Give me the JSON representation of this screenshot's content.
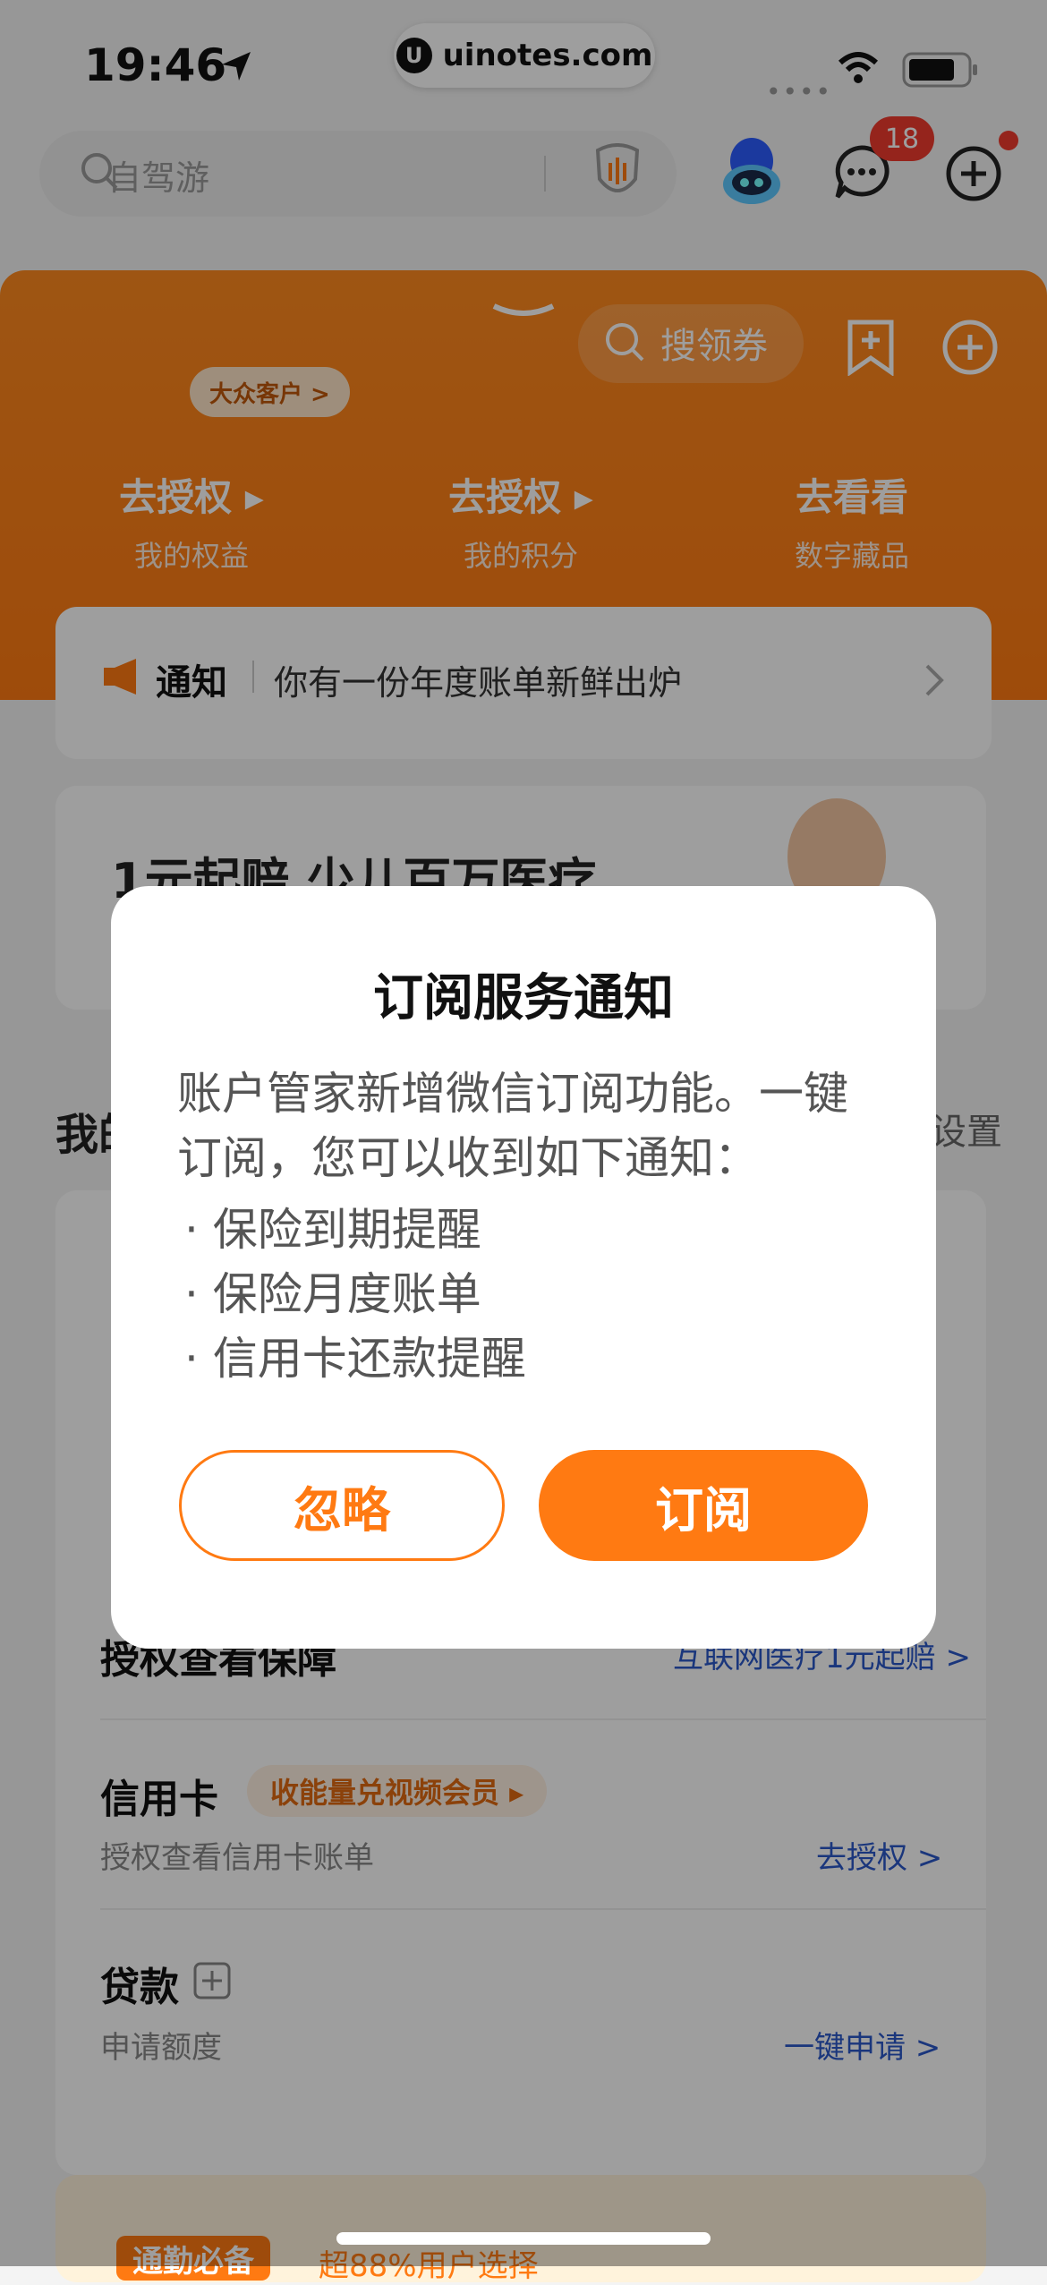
{
  "status": {
    "time": "19:46",
    "pill_text": "uinotes.com",
    "pill_logo": "U"
  },
  "header": {
    "search_placeholder": "自驾游",
    "message_badge": "18"
  },
  "banner": {
    "coupon_label": "搜领券",
    "vip_label": "大众客户 >",
    "stats": [
      {
        "value": "去授权 ▸",
        "label": "我的权益"
      },
      {
        "value": "去授权 ▸",
        "label": "我的积分"
      },
      {
        "value": "去看看",
        "label": "数字藏品"
      }
    ]
  },
  "notice": {
    "title": "通知",
    "text": "你有一份年度账单新鲜出炉"
  },
  "promo": {
    "text": "1元起赔 少儿百万医疗"
  },
  "section": {
    "left": "我的",
    "right": "设置"
  },
  "list": {
    "insurance": {
      "title": "授权查看保障",
      "link": "互联网医疗1元起赔 >"
    },
    "credit": {
      "title": "信用卡",
      "tag": "收能量兑视频会员 ▸",
      "sub": "授权查看信用卡账单",
      "link": "去授权 >"
    },
    "loan": {
      "title": "贷款",
      "sub": "申请额度",
      "link": "一键申请 >"
    }
  },
  "bottom": {
    "tag": "通勤必备",
    "text": "超88%用户选择"
  },
  "dialog": {
    "title": "订阅服务通知",
    "body": "账户管家新增微信订阅功能。一键订阅，您可以收到如下通知：",
    "items": [
      "· 保险到期提醒",
      "· 保险月度账单",
      "· 信用卡还款提醒"
    ],
    "ignore_label": "忽略",
    "subscribe_label": "订阅"
  },
  "colors": {
    "accent": "#ff7a12",
    "badge": "#f03b2e",
    "link": "#2b57c8"
  }
}
